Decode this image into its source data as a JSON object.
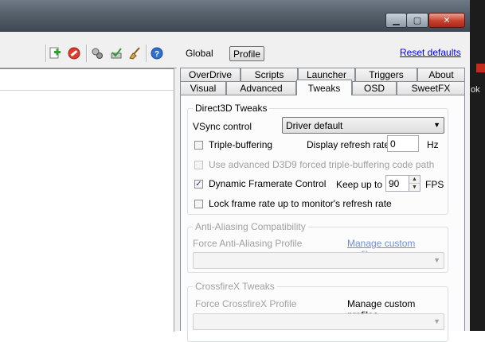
{
  "window": {
    "minimize_glyph": "▁",
    "maximize_glyph": "▢",
    "close_glyph": "✕",
    "side_text": "ok"
  },
  "toolbar": {
    "icons": [
      "add-profile-icon",
      "delete-profile-icon",
      "settings-icon",
      "apply-icon",
      "clean-icon",
      "help-icon"
    ]
  },
  "header": {
    "global_label": "Global",
    "profile_label": "Profile",
    "reset_link": "Reset defaults"
  },
  "tabs": {
    "row1": [
      "OverDrive",
      "Scripts",
      "Launcher",
      "Triggers",
      "About"
    ],
    "row2": [
      "Visual",
      "Advanced",
      "Tweaks",
      "OSD",
      "SweetFX"
    ],
    "active": "Tweaks"
  },
  "d3d": {
    "title": "Direct3D Tweaks",
    "vsync_label": "VSync control",
    "vsync_value": "Driver default",
    "triple_buffering": {
      "label": "Triple-buffering",
      "checked": false
    },
    "refresh_label": "Display refresh rate",
    "refresh_value": "0",
    "refresh_unit": "Hz",
    "advanced_d3d9": {
      "label": "Use advanced D3D9 forced triple-buffering code path",
      "checked": false,
      "enabled": false
    },
    "dynamic_framerate": {
      "label": "Dynamic Framerate Control",
      "checked": true,
      "check_glyph": "✓"
    },
    "keep_up_label": "Keep up to",
    "keep_up_value": "90",
    "fps_unit": "FPS",
    "lock_framerate": {
      "label": "Lock frame rate up to monitor's refresh rate",
      "checked": false
    }
  },
  "aa": {
    "title": "Anti-Aliasing Compatibility",
    "force_label": "Force Anti-Aliasing Profile",
    "manage_link": "Manage custom profiles"
  },
  "crossfire": {
    "title": "CrossfireX Tweaks",
    "force_label": "Force CrossfireX Profile",
    "manage_label": "Manage custom profiles"
  },
  "colors": {
    "link": "#0000ee",
    "disabled_text": "#a0a0a0",
    "close_red": "#c7402c"
  }
}
